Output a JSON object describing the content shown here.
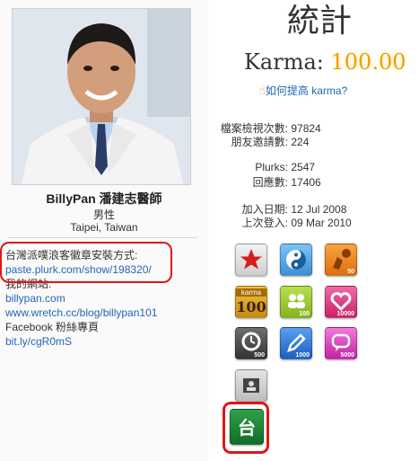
{
  "profile": {
    "name": "BillyPan 潘建志醫師",
    "gender": "男性",
    "location": "Taipei, Taiwan",
    "about": [
      {
        "kind": "text",
        "value": "台灣派噗浪客徽章安裝方式:"
      },
      {
        "kind": "link",
        "value": "paste.plurk.com/show/198320/"
      },
      {
        "kind": "text",
        "value": "我的網站:"
      },
      {
        "kind": "link",
        "value": "billypan.com"
      },
      {
        "kind": "link",
        "value": "www.wretch.cc/blog/billypan101"
      },
      {
        "kind": "text",
        "value": "Facebook 粉絲專頁"
      },
      {
        "kind": "link",
        "value": "bit.ly/cgR0mS"
      }
    ]
  },
  "stats": {
    "title": "統計",
    "karma_label": "Karma:",
    "karma_value": "100.00",
    "karma_help": "如何提高 karma?",
    "rows": [
      {
        "label": "檔案檢視次數:",
        "value": "97824"
      },
      {
        "label": "朋友邀請數:",
        "value": "224"
      },
      {
        "label": "Plurks:",
        "value": "2547"
      },
      {
        "label": "回應數:",
        "value": "17406"
      },
      {
        "label": "加入日期:",
        "value": "12 Jul 2008"
      },
      {
        "label": "上次登入:",
        "value": "09 Mar 2010"
      }
    ]
  },
  "badges": [
    {
      "icon": "star-icon",
      "color": "#d9d9d9",
      "num": ""
    },
    {
      "icon": "yin-yang-icon",
      "color": "#4aa6e8",
      "num": ""
    },
    {
      "icon": "basketball-icon",
      "color": "#f28c1c",
      "num": "50"
    },
    {
      "icon": "karma-100-icon",
      "color": "#d9a21c",
      "num": "",
      "label_top": "karma",
      "label_big": "100"
    },
    {
      "icon": "friends-icon",
      "color": "#9fcf2f",
      "num": "100"
    },
    {
      "icon": "heart-icon",
      "color": "#e83c8a",
      "num": "10000"
    },
    {
      "icon": "clock-icon",
      "color": "#555555",
      "num": "500"
    },
    {
      "icon": "pencil-icon",
      "color": "#2f79d9",
      "num": "1000"
    },
    {
      "icon": "speech-bubble-icon",
      "color": "#e04ac4",
      "num": "5000"
    },
    {
      "icon": "id-card-icon",
      "color": "#d5d5d5",
      "num": ""
    },
    {
      "icon": "taiwan-plurk-icon",
      "color": "#1f8a3a",
      "num": "",
      "label_big": "台"
    }
  ]
}
